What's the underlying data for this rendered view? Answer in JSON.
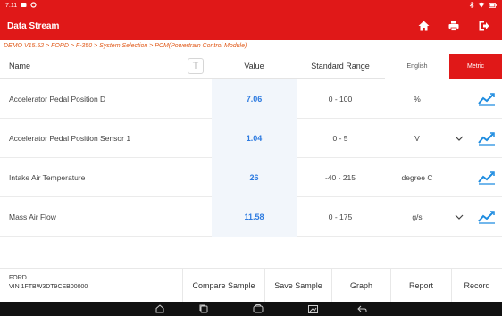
{
  "status_bar": {
    "time": "7:11",
    "left_icons": [
      "notification-icon",
      "settings-icon"
    ],
    "right_icons": [
      "bluetooth-icon",
      "wifi-icon",
      "battery-icon"
    ]
  },
  "title_bar": {
    "title": "Data Stream",
    "buttons": [
      "home-icon",
      "print-icon",
      "exit-icon"
    ]
  },
  "breadcrumb": "DEMO V15.52 > FORD > F-350 > System Selection > PCM(Powertrain Control Module)",
  "table": {
    "headers": {
      "name": "Name",
      "value": "Value",
      "range": "Standard Range"
    },
    "font_toggle": "T",
    "units_toggle": {
      "english": "English",
      "metric": "Metric",
      "selected": "Metric"
    },
    "rows": [
      {
        "name": "Accelerator Pedal Position D",
        "value": "7.06",
        "range": "0 - 100",
        "unit": "%",
        "has_dropdown": false
      },
      {
        "name": "Accelerator Pedal Position Sensor 1",
        "value": "1.04",
        "range": "0 - 5",
        "unit": "V",
        "has_dropdown": true
      },
      {
        "name": "Intake Air Temperature",
        "value": "26",
        "range": "-40 - 215",
        "unit": "degree C",
        "has_dropdown": false
      },
      {
        "name": "Mass Air Flow",
        "value": "11.58",
        "range": "0 - 175",
        "unit": "g/s",
        "has_dropdown": true
      }
    ]
  },
  "footer": {
    "vehicle_make": "FORD",
    "vin": "VIN 1FTBW3DT9CEB00000",
    "buttons": [
      "Compare Sample",
      "Save Sample",
      "Graph",
      "Report",
      "Record"
    ]
  },
  "nav_bar": {
    "icons": [
      "back-icon",
      "home-nav-icon",
      "recent-apps-icon",
      "vci-icon",
      "screenshot-icon",
      "return-icon"
    ]
  },
  "colors": {
    "brand": "#e01818",
    "value_text": "#2e7be0",
    "breadcrumb": "#e05a1a",
    "graph_icon": "#1e8ce0"
  }
}
